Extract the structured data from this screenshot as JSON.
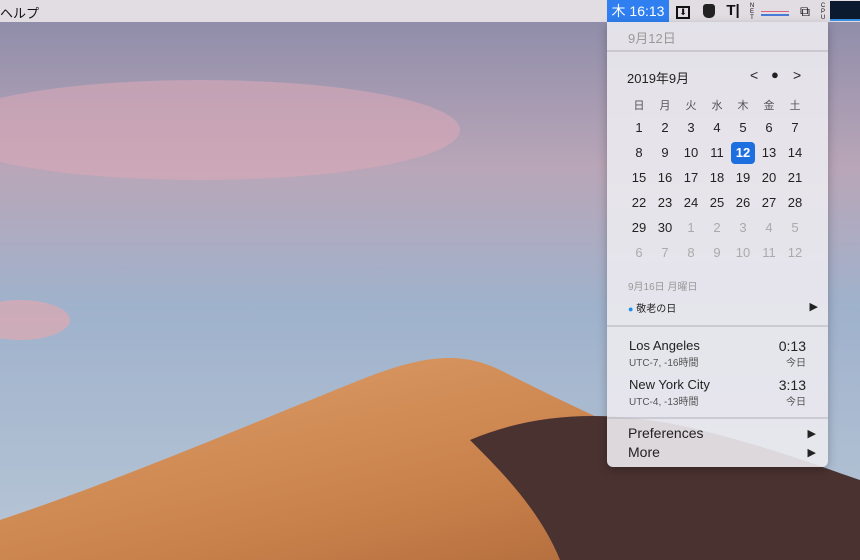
{
  "menubar": {
    "app_menu": "ヘルプ",
    "clock": "木 16:13",
    "icons": [
      "download-icon",
      "hat-icon",
      "text-cursor-icon",
      "net-monitor-icon",
      "window-icon",
      "cpu-monitor-icon"
    ],
    "net_label": "NET",
    "cpu_label": "CPU"
  },
  "panel": {
    "date_header": "9月12日",
    "calendar": {
      "title": "2019年9月",
      "prev": "<",
      "today": "●",
      "next": ">",
      "weekdays": [
        "日",
        "月",
        "火",
        "水",
        "木",
        "金",
        "土"
      ],
      "weeks": [
        [
          {
            "d": "1"
          },
          {
            "d": "2"
          },
          {
            "d": "3"
          },
          {
            "d": "4"
          },
          {
            "d": "5"
          },
          {
            "d": "6"
          },
          {
            "d": "7"
          }
        ],
        [
          {
            "d": "8"
          },
          {
            "d": "9"
          },
          {
            "d": "10"
          },
          {
            "d": "11"
          },
          {
            "d": "12",
            "today": true
          },
          {
            "d": "13"
          },
          {
            "d": "14"
          }
        ],
        [
          {
            "d": "15"
          },
          {
            "d": "16"
          },
          {
            "d": "17"
          },
          {
            "d": "18"
          },
          {
            "d": "19"
          },
          {
            "d": "20"
          },
          {
            "d": "21"
          }
        ],
        [
          {
            "d": "22"
          },
          {
            "d": "23"
          },
          {
            "d": "24"
          },
          {
            "d": "25"
          },
          {
            "d": "26"
          },
          {
            "d": "27"
          },
          {
            "d": "28"
          }
        ],
        [
          {
            "d": "29"
          },
          {
            "d": "30"
          },
          {
            "d": "1",
            "dim": true
          },
          {
            "d": "2",
            "dim": true
          },
          {
            "d": "3",
            "dim": true
          },
          {
            "d": "4",
            "dim": true
          },
          {
            "d": "5",
            "dim": true
          }
        ],
        [
          {
            "d": "6",
            "dim": true
          },
          {
            "d": "7",
            "dim": true
          },
          {
            "d": "8",
            "dim": true
          },
          {
            "d": "9",
            "dim": true
          },
          {
            "d": "10",
            "dim": true
          },
          {
            "d": "11",
            "dim": true
          },
          {
            "d": "12",
            "dim": true
          }
        ]
      ]
    },
    "event_date": "9月16日 月曜日",
    "event": {
      "title": "敬老の日",
      "color": "#1a8ef0"
    },
    "clocks": [
      {
        "city": "Los Angeles",
        "offset": "UTC-7, -16時間",
        "time": "0:13",
        "day": "今日"
      },
      {
        "city": "New York City",
        "offset": "UTC-4, -13時間",
        "time": "3:13",
        "day": "今日"
      }
    ],
    "menu": [
      {
        "label": "Preferences"
      },
      {
        "label": "More"
      }
    ]
  }
}
